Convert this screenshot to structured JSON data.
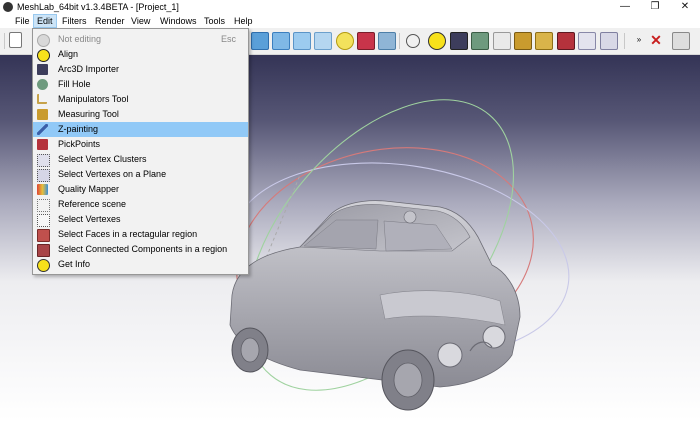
{
  "window": {
    "title": "MeshLab_64bit v1.3.4BETA - [Project_1]",
    "buttons": {
      "minimize": "—",
      "restore": "❐",
      "close": "✕"
    }
  },
  "menubar": {
    "items": [
      "File",
      "Edit",
      "Filters",
      "Render",
      "View",
      "Windows",
      "Tools",
      "Help"
    ],
    "active": "Edit"
  },
  "edit_menu": {
    "items": [
      {
        "label": "Not editing",
        "shortcut": "Esc",
        "enabled": false,
        "icon": "not-editing-icon"
      },
      {
        "label": "Align",
        "icon": "align-icon"
      },
      {
        "label": "Arc3D Importer",
        "icon": "arc3d-icon"
      },
      {
        "label": "Fill Hole",
        "icon": "fill-hole-icon"
      },
      {
        "label": "Manipulators Tool",
        "icon": "manipulators-icon"
      },
      {
        "label": "Measuring Tool",
        "icon": "measuring-icon"
      },
      {
        "label": "Z-painting",
        "icon": "z-painting-icon",
        "highlighted": true
      },
      {
        "label": "PickPoints",
        "icon": "pickpoints-icon"
      },
      {
        "label": "Select Vertex Clusters",
        "icon": "vertex-clusters-icon"
      },
      {
        "label": "Select Vertexes on a Plane",
        "icon": "vertexes-plane-icon"
      },
      {
        "label": "Quality Mapper",
        "icon": "quality-mapper-icon"
      },
      {
        "label": "Reference scene",
        "icon": "reference-scene-icon"
      },
      {
        "label": "Select Vertexes",
        "icon": "select-vertexes-icon"
      },
      {
        "label": "Select Faces in a rectagular region",
        "icon": "select-faces-icon"
      },
      {
        "label": "Select Connected Components in a region",
        "icon": "connected-components-icon"
      },
      {
        "label": "Get Info",
        "icon": "get-info-icon"
      }
    ]
  },
  "colors": {
    "menu_highlight": "#91c9f7",
    "menubar_active": "#cce4f7",
    "viewport_top": "#343456",
    "viewport_bottom": "#ffffff"
  }
}
